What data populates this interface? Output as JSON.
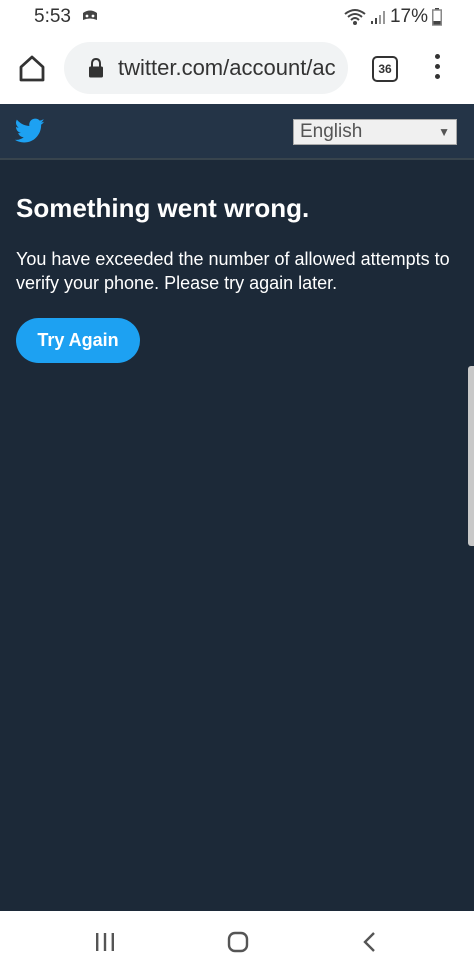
{
  "status_bar": {
    "time": "5:53",
    "battery": "17%"
  },
  "browser": {
    "url": "twitter.com/account/ac",
    "tab_count": "36"
  },
  "page": {
    "language_select": "English",
    "error_title": "Something went wrong.",
    "error_message": "You have exceeded the number of allowed attempts to verify your phone. Please try again later.",
    "try_again_label": "Try Again"
  },
  "colors": {
    "page_background": "#1c2938",
    "header_background": "#243447",
    "twitter_blue": "#1da1f2"
  },
  "icons": [
    "home-icon",
    "lock-icon",
    "tabs-icon",
    "more-vert-icon",
    "twitter-bird-icon",
    "wifi-icon",
    "signal-icon",
    "battery-icon",
    "recents-icon",
    "nav-home-icon",
    "back-icon"
  ]
}
